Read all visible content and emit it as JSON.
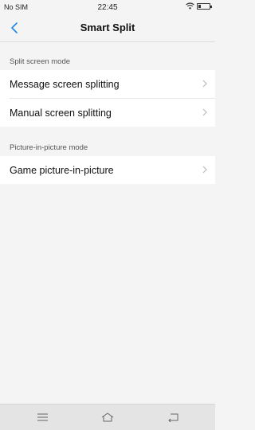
{
  "status_bar": {
    "carrier": "No SIM",
    "time": "22:45"
  },
  "header": {
    "title": "Smart Split",
    "back_icon": "chevron-left-icon"
  },
  "sections": [
    {
      "title": "Split screen mode",
      "items": [
        {
          "label": "Message screen splitting"
        },
        {
          "label": "Manual screen splitting"
        }
      ]
    },
    {
      "title": "Picture-in-picture mode",
      "items": [
        {
          "label": "Game picture-in-picture"
        }
      ]
    }
  ],
  "nav_bar": {
    "icons": [
      "menu-icon",
      "home-icon",
      "back-icon"
    ]
  },
  "colors": {
    "accent": "#1e88e5",
    "background": "#f4f4f4"
  }
}
